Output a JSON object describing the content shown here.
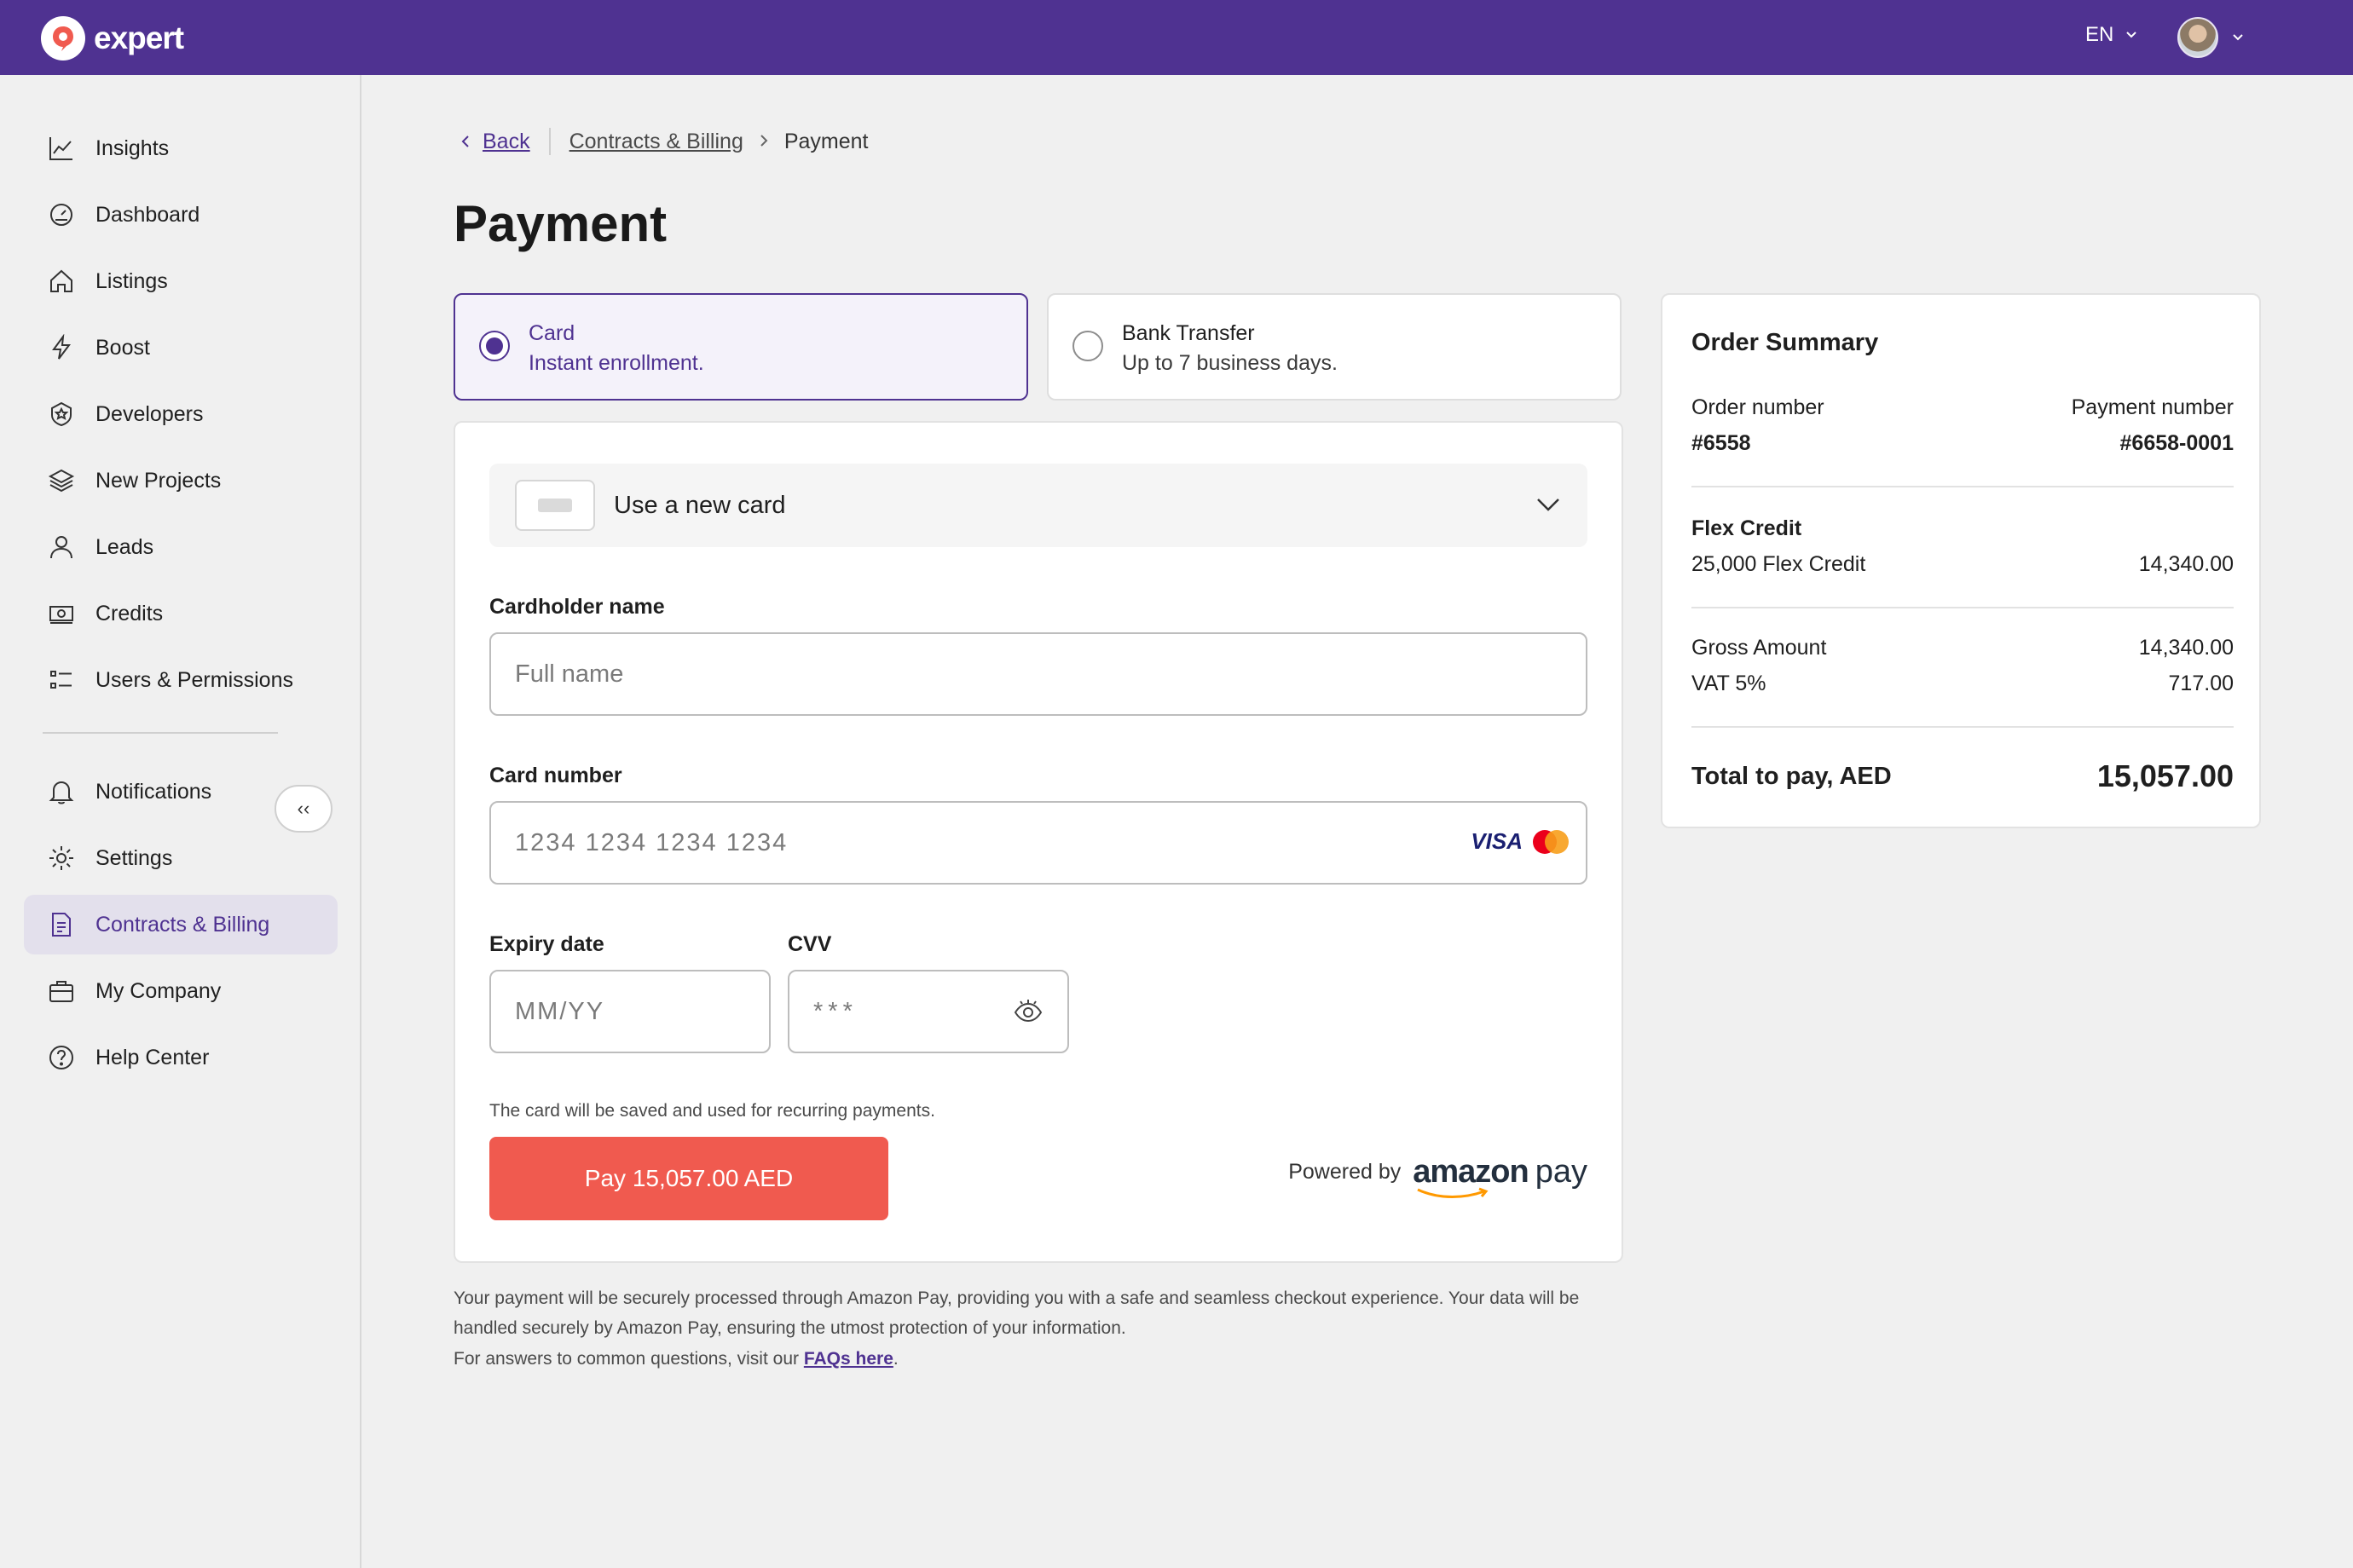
{
  "app": {
    "name": "expert",
    "language": "EN"
  },
  "colors": {
    "brand": "#4f3291",
    "pay_button": "#f05a4f",
    "active_nav_bg": "#e3e0ec"
  },
  "sidebar": {
    "items": [
      {
        "label": "Insights",
        "icon": "chart-line-icon"
      },
      {
        "label": "Dashboard",
        "icon": "gauge-icon"
      },
      {
        "label": "Listings",
        "icon": "home-icon"
      },
      {
        "label": "Boost",
        "icon": "lightning-icon"
      },
      {
        "label": "Developers",
        "icon": "badge-icon"
      },
      {
        "label": "New Projects",
        "icon": "layers-icon"
      },
      {
        "label": "Leads",
        "icon": "user-icon"
      },
      {
        "label": "Credits",
        "icon": "cash-icon"
      },
      {
        "label": "Users & Permissions",
        "icon": "list-icon"
      }
    ],
    "collapse_label": "‹‹",
    "bottom_items": [
      {
        "label": "Notifications",
        "icon": "bell-icon"
      },
      {
        "label": "Settings",
        "icon": "gear-icon"
      },
      {
        "label": "Contracts & Billing",
        "icon": "document-icon",
        "active": true
      },
      {
        "label": "My Company",
        "icon": "briefcase-icon"
      },
      {
        "label": "Help Center",
        "icon": "help-icon"
      }
    ]
  },
  "breadcrumb": {
    "back": "Back",
    "parent": "Contracts & Billing",
    "current": "Payment"
  },
  "page_title": "Payment",
  "payment_methods": [
    {
      "title": "Card",
      "subtitle": "Instant enrollment.",
      "selected": true
    },
    {
      "title": "Bank Transfer",
      "subtitle": "Up to 7 business days.",
      "selected": false
    }
  ],
  "form": {
    "card_select": "Use a new card",
    "cardholder": {
      "label": "Cardholder name",
      "placeholder": "Full name"
    },
    "card_number": {
      "label": "Card number",
      "placeholder": "1234 1234 1234 1234",
      "brand": "VISA"
    },
    "expiry": {
      "label": "Expiry date",
      "placeholder": "MM/YY"
    },
    "cvv": {
      "label": "CVV",
      "placeholder": "***"
    },
    "save_note": "The card will be saved and used for recurring payments.",
    "pay_button": "Pay 15,057.00 AED",
    "powered_by": "Powered by",
    "provider_word1": "amazon",
    "provider_word2": "pay"
  },
  "disclaimer": "Your payment will be securely processed through Amazon Pay, providing you with a safe and seamless checkout experience. Your data will be handled securely by Amazon Pay, ensuring the utmost protection of your information.",
  "faq": {
    "prefix": "For answers to common questions, visit our ",
    "link": "FAQs here",
    "suffix": "."
  },
  "summary": {
    "title": "Order Summary",
    "order_number_label": "Order number",
    "order_number": "#6558",
    "payment_number_label": "Payment number",
    "payment_number": "#6658-0001",
    "product": "Flex Credit",
    "line_item": "25,000 Flex Credit",
    "line_amount": "14,340.00",
    "gross_label": "Gross Amount",
    "gross_amount": "14,340.00",
    "vat_label": "VAT 5%",
    "vat_amount": "717.00",
    "total_label": "Total to pay, AED",
    "total_amount": "15,057.00"
  }
}
